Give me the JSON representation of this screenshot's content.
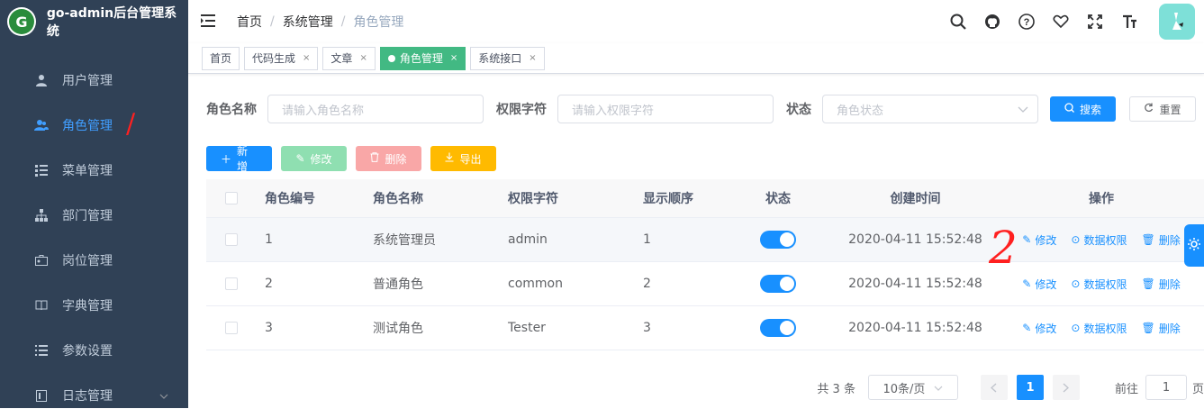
{
  "app": {
    "title": "go-admin后台管理系统",
    "logo_text": "G"
  },
  "sidebar": {
    "items": [
      {
        "label": "用户管理",
        "icon": "user-icon"
      },
      {
        "label": "角色管理",
        "icon": "role-icon",
        "active": true
      },
      {
        "label": "菜单管理",
        "icon": "menu-tree-icon"
      },
      {
        "label": "部门管理",
        "icon": "org-chart-icon"
      },
      {
        "label": "岗位管理",
        "icon": "post-icon"
      },
      {
        "label": "字典管理",
        "icon": "book-icon"
      },
      {
        "label": "参数设置",
        "icon": "list-icon"
      },
      {
        "label": "日志管理",
        "icon": "log-icon",
        "has_children": true
      }
    ]
  },
  "header": {
    "breadcrumb": [
      "首页",
      "系统管理",
      "角色管理"
    ],
    "tools": [
      "search-icon",
      "github-icon",
      "help-icon",
      "heart-icon",
      "fullscreen-icon",
      "font-size-icon"
    ]
  },
  "tags": [
    {
      "label": "首页",
      "closable": false
    },
    {
      "label": "代码生成",
      "closable": true
    },
    {
      "label": "文章",
      "closable": true
    },
    {
      "label": "角色管理",
      "closable": true,
      "active": true
    },
    {
      "label": "系统接口",
      "closable": true
    }
  ],
  "search": {
    "role_name_label": "角色名称",
    "role_name_placeholder": "请输入角色名称",
    "role_key_label": "权限字符",
    "role_key_placeholder": "请输入权限字符",
    "status_label": "状态",
    "status_placeholder": "角色状态",
    "search_button": "搜索",
    "reset_button": "重置"
  },
  "toolbar": {
    "add": "新增",
    "edit": "修改",
    "delete": "删除",
    "export": "导出"
  },
  "table": {
    "columns": [
      "角色编号",
      "角色名称",
      "权限字符",
      "显示顺序",
      "状态",
      "创建时间",
      "操作"
    ],
    "rows": [
      {
        "id": "1",
        "name": "系统管理员",
        "key": "admin",
        "sort": "1",
        "status": true,
        "created": "2020-04-11 15:52:48"
      },
      {
        "id": "2",
        "name": "普通角色",
        "key": "common",
        "sort": "2",
        "status": true,
        "created": "2020-04-11 15:52:48"
      },
      {
        "id": "3",
        "name": "测试角色",
        "key": "Tester",
        "sort": "3",
        "status": true,
        "created": "2020-04-11 15:52:48"
      }
    ],
    "ops": {
      "edit": "修改",
      "data_scope": "数据权限",
      "delete": "删除"
    }
  },
  "pagination": {
    "total": "共 3 条",
    "page_size": "10条/页",
    "current": "1",
    "goto_label": "前往",
    "goto_value": "1",
    "page_suffix": "页"
  },
  "annotations": {
    "mark1": "/",
    "mark2": "2"
  },
  "colors": {
    "sidebar_bg": "#304156",
    "primary": "#1890ff",
    "tag_active": "#42b983"
  }
}
